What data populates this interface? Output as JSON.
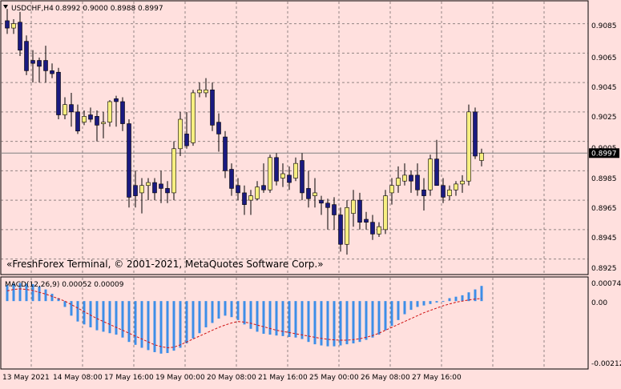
{
  "header": {
    "symbol_timeframe": "USDCHF,H4",
    "ohlc": "0.8992 0.9000 0.8988 0.8997",
    "menu_arrow_icon": "triangle-down-icon"
  },
  "watermark": "«FreshForex Terminal, © 2001-2021, MetaQuotes Software Corp.»",
  "colors": {
    "background": "#ffe0de",
    "grid": "#3a3a3a",
    "bear_candle": "#1a1a80",
    "bull_candle": "#f7ef80",
    "macd_hist": "#3d8ee8",
    "signal": "#d01010",
    "price_line": "#808080"
  },
  "price_axis": {
    "labels": [
      "0.9085",
      "0.9065",
      "0.9045",
      "0.9025",
      "0.9005",
      "0.8985",
      "0.8965",
      "0.8945",
      "0.8925"
    ],
    "current_price": "0.8997"
  },
  "macd_panel": {
    "label": "MACD(12,26,9) 0.00052 0.00009",
    "axis_labels": [
      "0.00074",
      "0.00",
      "-0.00212"
    ]
  },
  "time_axis": {
    "labels": [
      "13 May 2021",
      "14 May 08:00",
      "17 May 16:00",
      "19 May 00:00",
      "20 May 08:00",
      "21 May 16:00",
      "25 May 00:00",
      "26 May 08:00",
      "27 May 16:00"
    ]
  },
  "chart_data": {
    "type": "candlestick",
    "price_ylim": [
      0.8915,
      0.91
    ],
    "candles": [
      {
        "o": 0.9087,
        "h": 0.9095,
        "l": 0.9078,
        "c": 0.9082
      },
      {
        "o": 0.9082,
        "h": 0.9088,
        "l": 0.9078,
        "c": 0.9085
      },
      {
        "o": 0.9086,
        "h": 0.9093,
        "l": 0.9063,
        "c": 0.9067
      },
      {
        "o": 0.9073,
        "h": 0.9077,
        "l": 0.905,
        "c": 0.9053
      },
      {
        "o": 0.906,
        "h": 0.9067,
        "l": 0.9045,
        "c": 0.9058
      },
      {
        "o": 0.906,
        "h": 0.9062,
        "l": 0.9045,
        "c": 0.9056
      },
      {
        "o": 0.906,
        "h": 0.907,
        "l": 0.9045,
        "c": 0.9053
      },
      {
        "o": 0.9053,
        "h": 0.9058,
        "l": 0.9048,
        "c": 0.9051
      },
      {
        "o": 0.9052,
        "h": 0.9055,
        "l": 0.902,
        "c": 0.9023
      },
      {
        "o": 0.9023,
        "h": 0.9035,
        "l": 0.902,
        "c": 0.903
      },
      {
        "o": 0.903,
        "h": 0.9038,
        "l": 0.9015,
        "c": 0.9025
      },
      {
        "o": 0.9025,
        "h": 0.903,
        "l": 0.901,
        "c": 0.9012
      },
      {
        "o": 0.9018,
        "h": 0.9026,
        "l": 0.9016,
        "c": 0.9022
      },
      {
        "o": 0.9023,
        "h": 0.9028,
        "l": 0.9018,
        "c": 0.902
      },
      {
        "o": 0.9022,
        "h": 0.9026,
        "l": 0.9005,
        "c": 0.9016
      },
      {
        "o": 0.9017,
        "h": 0.9025,
        "l": 0.9007,
        "c": 0.9018
      },
      {
        "o": 0.9018,
        "h": 0.9033,
        "l": 0.9015,
        "c": 0.9032
      },
      {
        "o": 0.9034,
        "h": 0.9036,
        "l": 0.9015,
        "c": 0.9032
      },
      {
        "o": 0.9032,
        "h": 0.9035,
        "l": 0.9012,
        "c": 0.9017
      },
      {
        "o": 0.9017,
        "h": 0.902,
        "l": 0.896,
        "c": 0.8967
      },
      {
        "o": 0.8975,
        "h": 0.8985,
        "l": 0.896,
        "c": 0.8968
      },
      {
        "o": 0.897,
        "h": 0.898,
        "l": 0.8956,
        "c": 0.8975
      },
      {
        "o": 0.8975,
        "h": 0.898,
        "l": 0.8965,
        "c": 0.8977
      },
      {
        "o": 0.8977,
        "h": 0.898,
        "l": 0.8965,
        "c": 0.897
      },
      {
        "o": 0.8976,
        "h": 0.8985,
        "l": 0.8963,
        "c": 0.8973
      },
      {
        "o": 0.8973,
        "h": 0.8978,
        "l": 0.8963,
        "c": 0.897
      },
      {
        "o": 0.897,
        "h": 0.9005,
        "l": 0.8965,
        "c": 0.9
      },
      {
        "o": 0.9,
        "h": 0.9025,
        "l": 0.8995,
        "c": 0.902
      },
      {
        "o": 0.901,
        "h": 0.9025,
        "l": 0.9,
        "c": 0.9002
      },
      {
        "o": 0.9004,
        "h": 0.904,
        "l": 0.9002,
        "c": 0.9038
      },
      {
        "o": 0.9038,
        "h": 0.9045,
        "l": 0.9035,
        "c": 0.904
      },
      {
        "o": 0.9038,
        "h": 0.9048,
        "l": 0.9035,
        "c": 0.904
      },
      {
        "o": 0.904,
        "h": 0.9045,
        "l": 0.9012,
        "c": 0.9016
      },
      {
        "o": 0.9018,
        "h": 0.9024,
        "l": 0.8998,
        "c": 0.901
      },
      {
        "o": 0.9008,
        "h": 0.9012,
        "l": 0.898,
        "c": 0.8985
      },
      {
        "o": 0.8986,
        "h": 0.899,
        "l": 0.8968,
        "c": 0.8973
      },
      {
        "o": 0.8975,
        "h": 0.898,
        "l": 0.8965,
        "c": 0.897
      },
      {
        "o": 0.897,
        "h": 0.8975,
        "l": 0.8955,
        "c": 0.8962
      },
      {
        "o": 0.8965,
        "h": 0.8972,
        "l": 0.8955,
        "c": 0.8968
      },
      {
        "o": 0.8966,
        "h": 0.8978,
        "l": 0.8965,
        "c": 0.8974
      },
      {
        "o": 0.8975,
        "h": 0.899,
        "l": 0.897,
        "c": 0.8972
      },
      {
        "o": 0.8972,
        "h": 0.8996,
        "l": 0.897,
        "c": 0.8994
      },
      {
        "o": 0.8994,
        "h": 0.8997,
        "l": 0.8975,
        "c": 0.8978
      },
      {
        "o": 0.898,
        "h": 0.899,
        "l": 0.8974,
        "c": 0.8983
      },
      {
        "o": 0.8982,
        "h": 0.8988,
        "l": 0.8972,
        "c": 0.8977
      },
      {
        "o": 0.898,
        "h": 0.8994,
        "l": 0.8978,
        "c": 0.899
      },
      {
        "o": 0.8992,
        "h": 0.8997,
        "l": 0.8965,
        "c": 0.897
      },
      {
        "o": 0.8973,
        "h": 0.8985,
        "l": 0.896,
        "c": 0.8966
      },
      {
        "o": 0.8968,
        "h": 0.898,
        "l": 0.896,
        "c": 0.897
      },
      {
        "o": 0.8965,
        "h": 0.8968,
        "l": 0.8955,
        "c": 0.8963
      },
      {
        "o": 0.8963,
        "h": 0.8966,
        "l": 0.8945,
        "c": 0.896
      },
      {
        "o": 0.8962,
        "h": 0.8967,
        "l": 0.8945,
        "c": 0.8955
      },
      {
        "o": 0.8955,
        "h": 0.896,
        "l": 0.893,
        "c": 0.8935
      },
      {
        "o": 0.8935,
        "h": 0.8965,
        "l": 0.8928,
        "c": 0.896
      },
      {
        "o": 0.8956,
        "h": 0.8972,
        "l": 0.8947,
        "c": 0.8965
      },
      {
        "o": 0.8965,
        "h": 0.897,
        "l": 0.8945,
        "c": 0.895
      },
      {
        "o": 0.8952,
        "h": 0.8957,
        "l": 0.8945,
        "c": 0.895
      },
      {
        "o": 0.895,
        "h": 0.8955,
        "l": 0.8938,
        "c": 0.8942
      },
      {
        "o": 0.8942,
        "h": 0.895,
        "l": 0.894,
        "c": 0.8947
      },
      {
        "o": 0.8945,
        "h": 0.8972,
        "l": 0.8942,
        "c": 0.8968
      },
      {
        "o": 0.897,
        "h": 0.898,
        "l": 0.8962,
        "c": 0.8975
      },
      {
        "o": 0.8975,
        "h": 0.8988,
        "l": 0.897,
        "c": 0.898
      },
      {
        "o": 0.8978,
        "h": 0.899,
        "l": 0.8975,
        "c": 0.8982
      },
      {
        "o": 0.8982,
        "h": 0.8985,
        "l": 0.897,
        "c": 0.8978
      },
      {
        "o": 0.8982,
        "h": 0.899,
        "l": 0.8968,
        "c": 0.8972
      },
      {
        "o": 0.8972,
        "h": 0.898,
        "l": 0.8958,
        "c": 0.8968
      },
      {
        "o": 0.8972,
        "h": 0.8996,
        "l": 0.8968,
        "c": 0.8993
      },
      {
        "o": 0.8993,
        "h": 0.9006,
        "l": 0.8975,
        "c": 0.8975
      },
      {
        "o": 0.8975,
        "h": 0.898,
        "l": 0.8963,
        "c": 0.8967
      },
      {
        "o": 0.8968,
        "h": 0.8975,
        "l": 0.8965,
        "c": 0.8972
      },
      {
        "o": 0.8972,
        "h": 0.8978,
        "l": 0.8968,
        "c": 0.8976
      },
      {
        "o": 0.8976,
        "h": 0.8982,
        "l": 0.897,
        "c": 0.8978
      },
      {
        "o": 0.8978,
        "h": 0.903,
        "l": 0.8975,
        "c": 0.9025
      },
      {
        "o": 0.9025,
        "h": 0.9028,
        "l": 0.8993,
        "c": 0.8995
      },
      {
        "o": 0.8992,
        "h": 0.9,
        "l": 0.8988,
        "c": 0.8997
      }
    ],
    "macd_ylim": [
      -0.0023,
      0.0008
    ],
    "macd_hist": [
      0.00055,
      0.0006,
      0.00062,
      0.0006,
      0.00058,
      0.0005,
      0.0004,
      0.00025,
      0.0001,
      -0.0002,
      -0.0005,
      -0.0007,
      -0.0008,
      -0.0009,
      -0.001,
      -0.00105,
      -0.0011,
      -0.00115,
      -0.00125,
      -0.0014,
      -0.0015,
      -0.0016,
      -0.00168,
      -0.00175,
      -0.0018,
      -0.00178,
      -0.0017,
      -0.0016,
      -0.00145,
      -0.00128,
      -0.0011,
      -0.0009,
      -0.00075,
      -0.0006,
      -0.0005,
      -0.00055,
      -0.00065,
      -0.0008,
      -0.00095,
      -0.00105,
      -0.00112,
      -0.00115,
      -0.00118,
      -0.0012,
      -0.00123,
      -0.00125,
      -0.0013,
      -0.0014,
      -0.00148,
      -0.00152,
      -0.00155,
      -0.00155,
      -0.00152,
      -0.00148,
      -0.00145,
      -0.0014,
      -0.00133,
      -0.00125,
      -0.00115,
      -0.001,
      -0.00085,
      -0.00065,
      -0.00045,
      -0.0003,
      -0.0002,
      -0.00015,
      -0.0001,
      -5e-05,
      0.0,
      0.0001,
      0.00015,
      0.0002,
      0.0003,
      0.0004,
      0.00052
    ],
    "macd_signal": [
      0.00035,
      0.0004,
      0.00042,
      0.0004,
      0.00036,
      0.0003,
      0.00024,
      0.00016,
      8e-05,
      0.0,
      -0.00012,
      -0.00024,
      -0.00036,
      -0.00048,
      -0.0006,
      -0.0007,
      -0.0008,
      -0.0009,
      -0.001,
      -0.0011,
      -0.0012,
      -0.0013,
      -0.0014,
      -0.0015,
      -0.00156,
      -0.0016,
      -0.00158,
      -0.0015,
      -0.0014,
      -0.0013,
      -0.0012,
      -0.0011,
      -0.001,
      -0.0009,
      -0.00082,
      -0.00075,
      -0.0007,
      -0.00072,
      -0.00076,
      -0.00082,
      -0.00088,
      -0.00094,
      -0.001,
      -0.00104,
      -0.00108,
      -0.00112,
      -0.00116,
      -0.0012,
      -0.00124,
      -0.00128,
      -0.00131,
      -0.00133,
      -0.00134,
      -0.00134,
      -0.00132,
      -0.00129,
      -0.00124,
      -0.00118,
      -0.0011,
      -0.001,
      -0.0009,
      -0.0008,
      -0.0007,
      -0.0006,
      -0.0005,
      -0.0004,
      -0.00032,
      -0.00024,
      -0.00016,
      -0.0001,
      -4e-05,
      0.0,
      4e-05,
      7e-05,
      9e-05
    ]
  }
}
